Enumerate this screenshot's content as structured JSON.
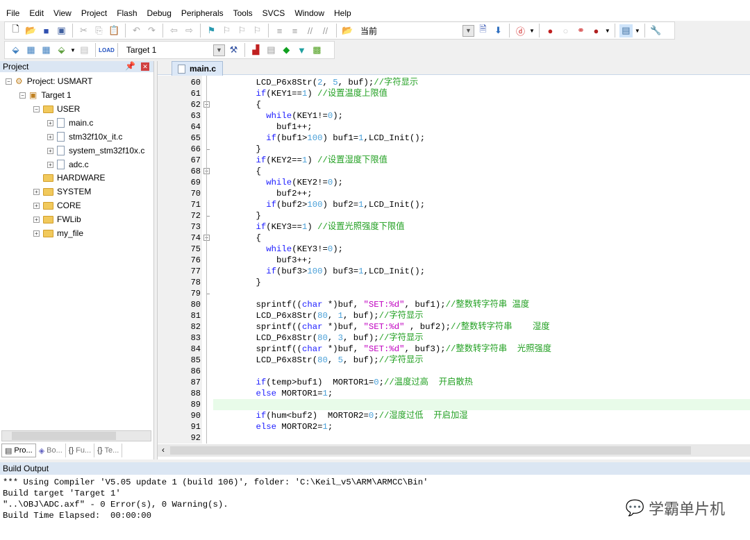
{
  "menu": [
    "File",
    "Edit",
    "View",
    "Project",
    "Flash",
    "Debug",
    "Peripherals",
    "Tools",
    "SVCS",
    "Window",
    "Help"
  ],
  "toolbar1": {
    "find_combo": "当前"
  },
  "toolbar2": {
    "target_combo": "Target 1"
  },
  "project_panel": {
    "title": "Project",
    "tree": [
      {
        "label": "Project: USMART",
        "level": 0,
        "kind": "project"
      },
      {
        "label": "Target 1",
        "level": 1,
        "kind": "target"
      },
      {
        "label": "USER",
        "level": 2,
        "kind": "folder"
      },
      {
        "label": "main.c",
        "level": 3,
        "kind": "file"
      },
      {
        "label": "stm32f10x_it.c",
        "level": 3,
        "kind": "file"
      },
      {
        "label": "system_stm32f10x.c",
        "level": 3,
        "kind": "file"
      },
      {
        "label": "adc.c",
        "level": 3,
        "kind": "file"
      },
      {
        "label": "HARDWARE",
        "level": 2,
        "kind": "folder"
      },
      {
        "label": "SYSTEM",
        "level": 2,
        "kind": "folder"
      },
      {
        "label": "CORE",
        "level": 2,
        "kind": "folder"
      },
      {
        "label": "FWLib",
        "level": 2,
        "kind": "folder"
      },
      {
        "label": "my_file",
        "level": 2,
        "kind": "folder"
      }
    ],
    "tabs": [
      "Pro...",
      "Bo...",
      "Fu...",
      "Te..."
    ]
  },
  "editor": {
    "tab": "main.c",
    "current_line": 89,
    "lines": [
      {
        "no": 60,
        "t": [
          [
            "p",
            "    LCD_P6x8Str("
          ],
          [
            "n",
            "2"
          ],
          [
            "p",
            ", "
          ],
          [
            "n",
            "5"
          ],
          [
            "p",
            ", buf);"
          ],
          [
            "c",
            "//字符显示"
          ]
        ]
      },
      {
        "no": 61,
        "t": [
          [
            "k",
            "    if"
          ],
          [
            "p",
            "(KEY1=="
          ],
          [
            "n",
            "1"
          ],
          [
            "p",
            ") "
          ],
          [
            "c",
            "//设置温度上限值"
          ]
        ]
      },
      {
        "no": 62,
        "fold": "open",
        "t": [
          [
            "p",
            "    {"
          ]
        ]
      },
      {
        "no": 63,
        "t": [
          [
            "k",
            "      while"
          ],
          [
            "p",
            "(KEY1!="
          ],
          [
            "n",
            "0"
          ],
          [
            "p",
            ");"
          ]
        ]
      },
      {
        "no": 64,
        "t": [
          [
            "p",
            "        buf1++;"
          ]
        ]
      },
      {
        "no": 65,
        "t": [
          [
            "k",
            "      if"
          ],
          [
            "p",
            "(buf1>"
          ],
          [
            "n",
            "100"
          ],
          [
            "p",
            ") buf1="
          ],
          [
            "n",
            "1"
          ],
          [
            "p",
            ",LCD_Init();"
          ]
        ]
      },
      {
        "no": 66,
        "fold": "end",
        "t": [
          [
            "p",
            "    }"
          ]
        ]
      },
      {
        "no": 67,
        "t": [
          [
            "k",
            "    if"
          ],
          [
            "p",
            "(KEY2=="
          ],
          [
            "n",
            "1"
          ],
          [
            "p",
            ") "
          ],
          [
            "c",
            "//设置湿度下限值"
          ]
        ]
      },
      {
        "no": 68,
        "fold": "open",
        "t": [
          [
            "p",
            "    {"
          ]
        ]
      },
      {
        "no": 69,
        "t": [
          [
            "k",
            "      while"
          ],
          [
            "p",
            "(KEY2!="
          ],
          [
            "n",
            "0"
          ],
          [
            "p",
            ");"
          ]
        ]
      },
      {
        "no": 70,
        "t": [
          [
            "p",
            "        buf2++;"
          ]
        ]
      },
      {
        "no": 71,
        "t": [
          [
            "k",
            "      if"
          ],
          [
            "p",
            "(buf2>"
          ],
          [
            "n",
            "100"
          ],
          [
            "p",
            ") buf2="
          ],
          [
            "n",
            "1"
          ],
          [
            "p",
            ",LCD_Init();"
          ]
        ]
      },
      {
        "no": 72,
        "fold": "end",
        "t": [
          [
            "p",
            "    }"
          ]
        ]
      },
      {
        "no": 73,
        "t": [
          [
            "k",
            "    if"
          ],
          [
            "p",
            "(KEY3=="
          ],
          [
            "n",
            "1"
          ],
          [
            "p",
            ") "
          ],
          [
            "c",
            "//设置光照强度下限值"
          ]
        ]
      },
      {
        "no": 74,
        "fold": "open",
        "t": [
          [
            "p",
            "    {"
          ]
        ]
      },
      {
        "no": 75,
        "t": [
          [
            "k",
            "      while"
          ],
          [
            "p",
            "(KEY3!="
          ],
          [
            "n",
            "0"
          ],
          [
            "p",
            ");"
          ]
        ]
      },
      {
        "no": 76,
        "t": [
          [
            "p",
            "        buf3++;"
          ]
        ]
      },
      {
        "no": 77,
        "t": [
          [
            "k",
            "      if"
          ],
          [
            "p",
            "(buf3>"
          ],
          [
            "n",
            "100"
          ],
          [
            "p",
            ") buf3="
          ],
          [
            "n",
            "1"
          ],
          [
            "p",
            ",LCD_Init();"
          ]
        ]
      },
      {
        "no": 78,
        "t": [
          [
            "p",
            "    }"
          ]
        ]
      },
      {
        "no": 79,
        "fold": "end",
        "t": []
      },
      {
        "no": 80,
        "t": [
          [
            "p",
            "    sprintf(("
          ],
          [
            "k",
            "char"
          ],
          [
            "p",
            " *)buf, "
          ],
          [
            "s",
            "\"SET:%d\""
          ],
          [
            "p",
            ", buf1);"
          ],
          [
            "c",
            "//整数转字符串 温度"
          ]
        ]
      },
      {
        "no": 81,
        "t": [
          [
            "p",
            "    LCD_P6x8Str("
          ],
          [
            "n",
            "80"
          ],
          [
            "p",
            ", "
          ],
          [
            "n",
            "1"
          ],
          [
            "p",
            ", buf);"
          ],
          [
            "c",
            "//字符显示"
          ]
        ]
      },
      {
        "no": 82,
        "t": [
          [
            "p",
            "    sprintf(("
          ],
          [
            "k",
            "char"
          ],
          [
            "p",
            " *)buf, "
          ],
          [
            "s",
            "\"SET:%d\""
          ],
          [
            "p",
            " , buf2);"
          ],
          [
            "c",
            "//整数转字符串    湿度"
          ]
        ]
      },
      {
        "no": 83,
        "t": [
          [
            "p",
            "    LCD_P6x8Str("
          ],
          [
            "n",
            "80"
          ],
          [
            "p",
            ", "
          ],
          [
            "n",
            "3"
          ],
          [
            "p",
            ", buf);"
          ],
          [
            "c",
            "//字符显示"
          ]
        ]
      },
      {
        "no": 84,
        "t": [
          [
            "p",
            "    sprintf(("
          ],
          [
            "k",
            "char"
          ],
          [
            "p",
            " *)buf, "
          ],
          [
            "s",
            "\"SET:%d\""
          ],
          [
            "p",
            ", buf3);"
          ],
          [
            "c",
            "//整数转字符串  光照强度"
          ]
        ]
      },
      {
        "no": 85,
        "t": [
          [
            "p",
            "    LCD_P6x8Str("
          ],
          [
            "n",
            "80"
          ],
          [
            "p",
            ", "
          ],
          [
            "n",
            "5"
          ],
          [
            "p",
            ", buf);"
          ],
          [
            "c",
            "//字符显示"
          ]
        ]
      },
      {
        "no": 86,
        "t": []
      },
      {
        "no": 87,
        "t": [
          [
            "k",
            "    if"
          ],
          [
            "p",
            "(temp>buf1)  MORTOR1="
          ],
          [
            "n",
            "0"
          ],
          [
            "p",
            ";"
          ],
          [
            "c",
            "//温度过高  开启散热"
          ]
        ]
      },
      {
        "no": 88,
        "t": [
          [
            "k",
            "    else"
          ],
          [
            "p",
            " MORTOR1="
          ],
          [
            "n",
            "1"
          ],
          [
            "p",
            ";"
          ]
        ]
      },
      {
        "no": 89,
        "t": []
      },
      {
        "no": 90,
        "t": [
          [
            "k",
            "    if"
          ],
          [
            "p",
            "(hum<buf2)  MORTOR2="
          ],
          [
            "n",
            "0"
          ],
          [
            "p",
            ";"
          ],
          [
            "c",
            "//湿度过低  开启加湿"
          ]
        ]
      },
      {
        "no": 91,
        "t": [
          [
            "k",
            "    else"
          ],
          [
            "p",
            " MORTOR2="
          ],
          [
            "n",
            "1"
          ],
          [
            "p",
            ";"
          ]
        ]
      },
      {
        "no": 92,
        "t": []
      }
    ]
  },
  "build_output": {
    "title": "Build Output",
    "lines": [
      "*** Using Compiler 'V5.05 update 1 (build 106)', folder: 'C:\\Keil_v5\\ARM\\ARMCC\\Bin'",
      "Build target 'Target 1'",
      "\"..\\OBJ\\ADC.axf\" - 0 Error(s), 0 Warning(s).",
      "Build Time Elapsed:  00:00:00"
    ]
  },
  "watermark": "学霸单片机",
  "colors": {
    "keyword": "#2020ff",
    "number": "#4aa0d8",
    "string": "#c000c0",
    "comment": "#22a022",
    "current_line": "#e8fbe9"
  }
}
